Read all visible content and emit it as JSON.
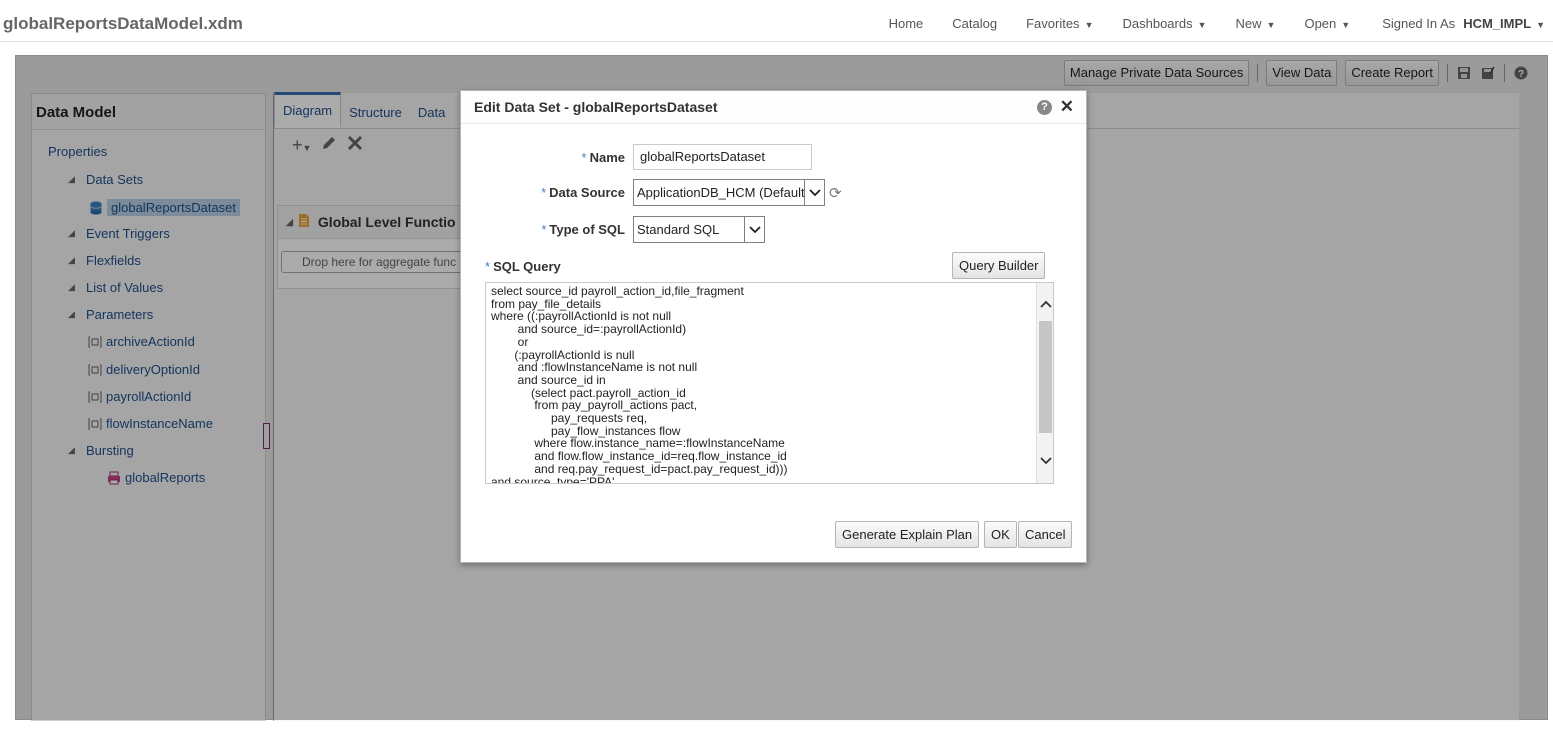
{
  "header": {
    "app_title": "globalReportsDataModel.xdm",
    "nav": [
      {
        "label": "Home",
        "dropdown": false
      },
      {
        "label": "Catalog",
        "dropdown": false
      },
      {
        "label": "Favorites",
        "dropdown": true
      },
      {
        "label": "Dashboards",
        "dropdown": true
      },
      {
        "label": "New",
        "dropdown": true
      },
      {
        "label": "Open",
        "dropdown": true
      }
    ],
    "signed_in_label": "Signed In As",
    "user": "HCM_IMPL"
  },
  "toolbar": {
    "manage_label": "Manage Private Data Sources",
    "view_data_label": "View Data",
    "create_report_label": "Create Report"
  },
  "left_panel": {
    "title": "Data Model",
    "items": {
      "properties": "Properties",
      "data_sets": "Data Sets",
      "dataset": "globalReportsDataset",
      "event_triggers": "Event Triggers",
      "flexfields": "Flexfields",
      "list_of_values": "List of Values",
      "parameters": "Parameters",
      "param1": "archiveActionId",
      "param2": "deliveryOptionId",
      "param3": "payrollActionId",
      "param4": "flowInstanceName",
      "bursting": "Bursting",
      "burst1": "globalReports"
    }
  },
  "center": {
    "tabs": [
      "Diagram",
      "Structure",
      "Data"
    ],
    "card_title": "Global Level Functio",
    "drop_text": "Drop here for aggregate func"
  },
  "dialog": {
    "title": "Edit Data Set - globalReportsDataset",
    "required_marker": "*",
    "name_label": "Name",
    "name_value": "globalReportsDataset",
    "data_source_label": "Data Source",
    "data_source_value": "ApplicationDB_HCM (Default)",
    "sql_type_label": "Type of SQL",
    "sql_type_value": "Standard SQL",
    "sql_query_label": "SQL Query",
    "query_builder_label": "Query Builder",
    "sql_text": "select source_id payroll_action_id,file_fragment\nfrom pay_file_details\nwhere ((:payrollActionId is not null\n        and source_id=:payrollActionId)\n        or\n       (:payrollActionId is null\n        and :flowInstanceName is not null\n        and source_id in\n            (select pact.payroll_action_id\n             from pay_payroll_actions pact,\n                  pay_requests req,\n                  pay_flow_instances flow\n             where flow.instance_name=:flowInstanceName\n             and flow.flow_instance_id=req.flow_instance_id\n             and req.pay_request_id=pact.pay_request_id)))\nand source_type='PPA'",
    "explain_plan_label": "Generate Explain Plan",
    "ok_label": "OK",
    "cancel_label": "Cancel"
  }
}
